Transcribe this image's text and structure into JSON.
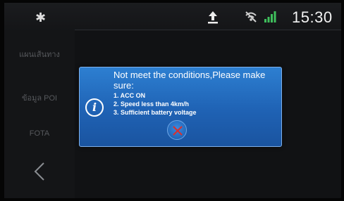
{
  "statusbar": {
    "icons": [
      "bluetooth-icon",
      "upload-icon",
      "no-signal-icon",
      "cellular-signal-icon"
    ],
    "time": "15:30"
  },
  "sidebar": {
    "items": [
      {
        "label": "แผนเส้นทาง"
      },
      {
        "label": "ข้อมูล POI"
      },
      {
        "label": "FOTA"
      }
    ],
    "back_icon": "chevron-left-icon"
  },
  "dialog": {
    "icon": "info-icon",
    "title": "Not meet the conditions,Please make sure:",
    "conditions": [
      "1. ACC ON",
      "2. Speed less than 4km/h",
      "3. Sufficient battery voltage"
    ],
    "close_icon": "close-icon",
    "colors": {
      "background": "#1f62b4",
      "border": "#7fb0ea",
      "close_x": "#d8312f"
    }
  }
}
